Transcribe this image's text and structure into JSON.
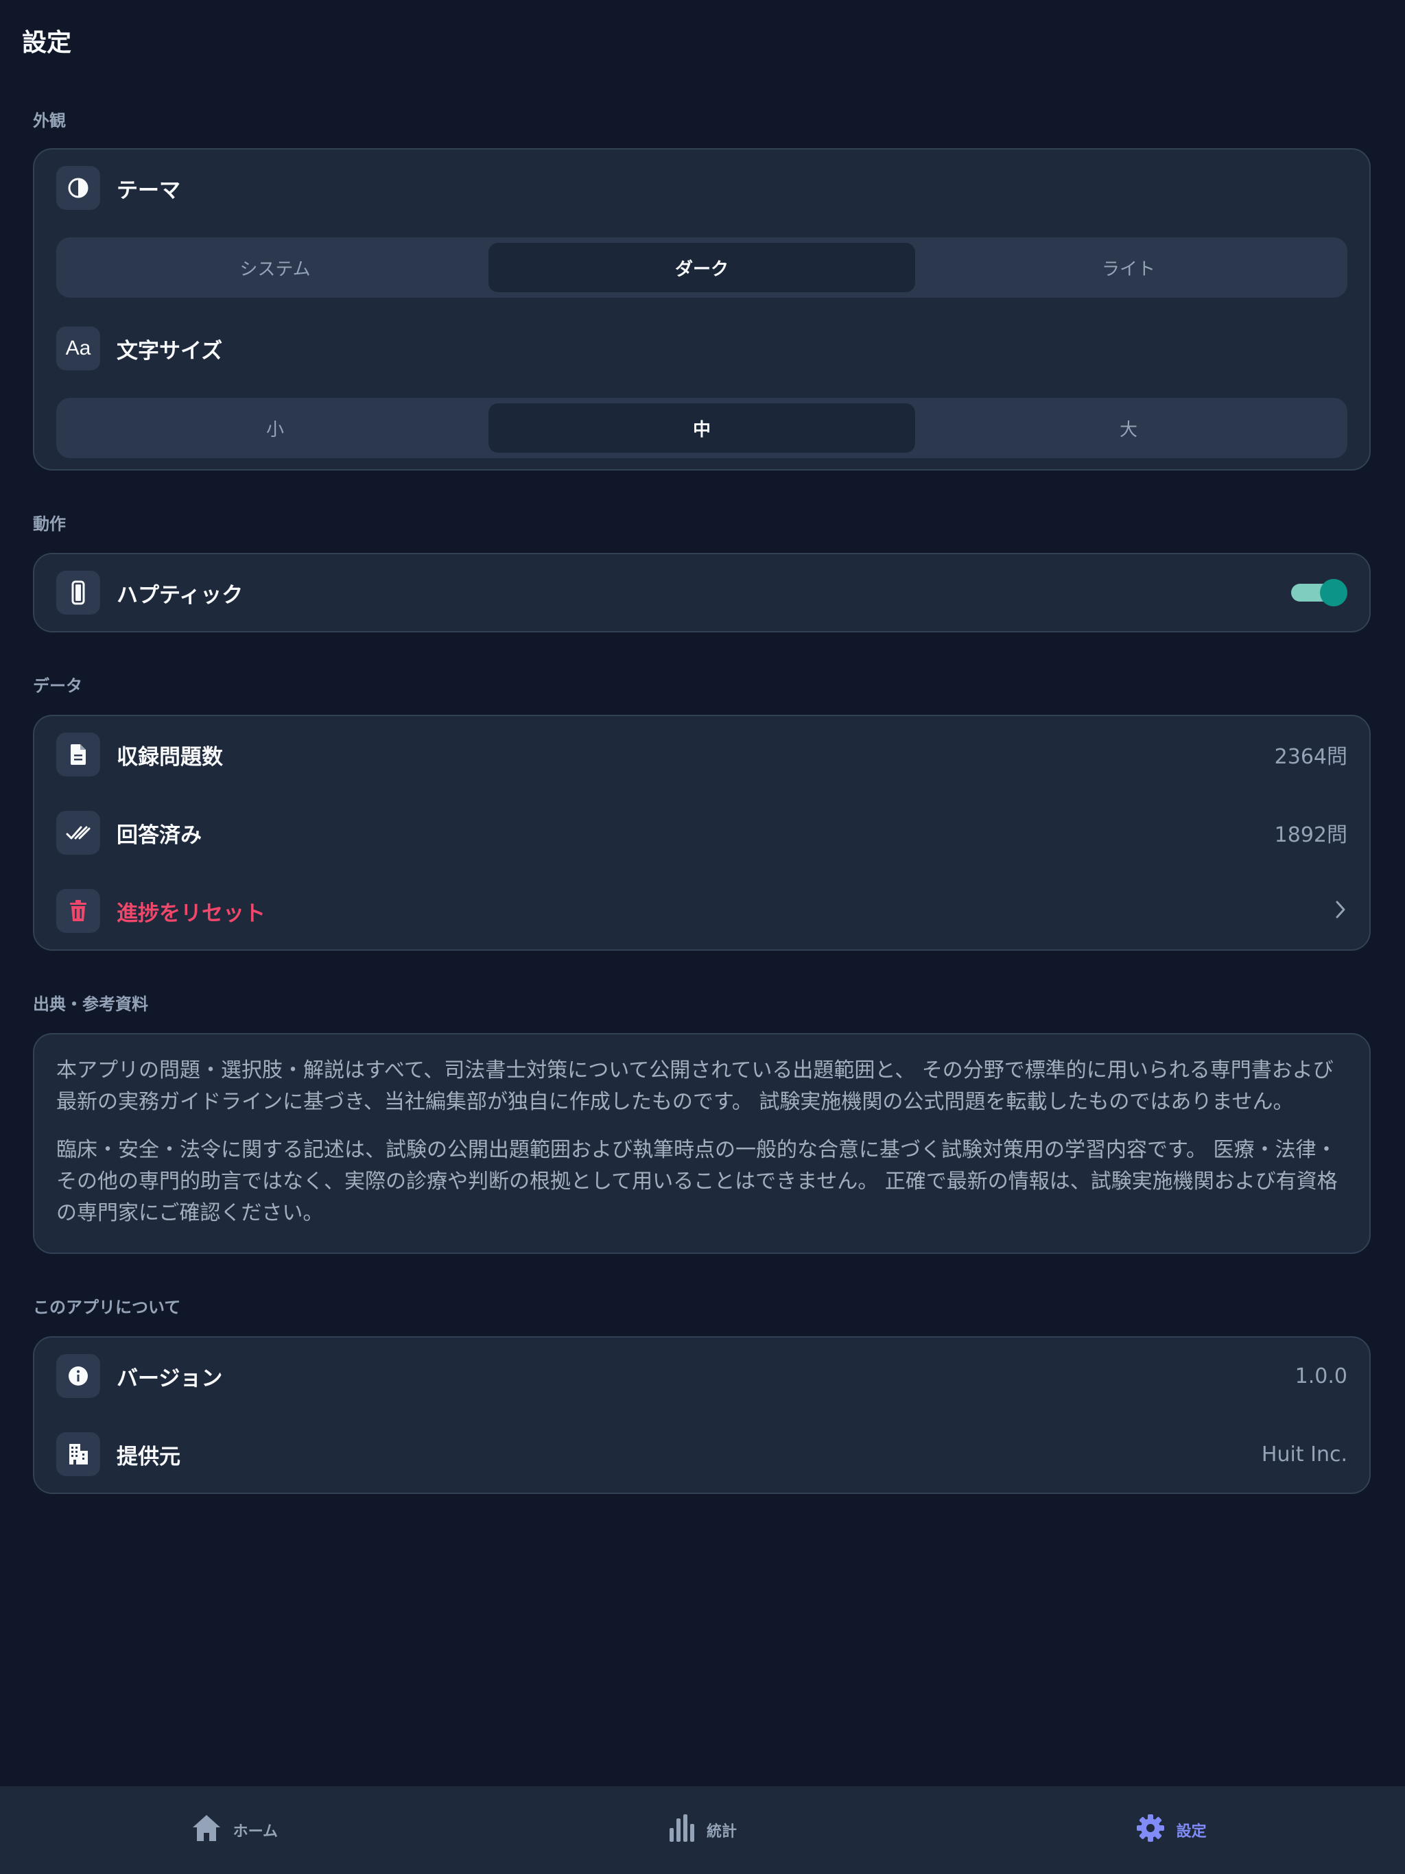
{
  "header": {
    "title": "設定"
  },
  "appearance": {
    "section_label": "外観",
    "theme": {
      "label": "テーマ",
      "icon": "contrast-icon",
      "options": [
        "システム",
        "ダーク",
        "ライト"
      ],
      "selected": "ダーク"
    },
    "font_size": {
      "label": "文字サイズ",
      "icon": "text-size-icon",
      "options": [
        "小",
        "中",
        "大"
      ],
      "selected": "中"
    }
  },
  "behavior": {
    "section_label": "動作",
    "haptic": {
      "label": "ハプティック",
      "icon": "phone-icon",
      "enabled": true
    }
  },
  "data_section": {
    "section_label": "データ",
    "total_questions": {
      "label": "収録問題数",
      "value": "2364問",
      "icon": "document-icon"
    },
    "answered": {
      "label": "回答済み",
      "value": "1892問",
      "icon": "double-check-icon"
    },
    "reset": {
      "label": "進捗をリセット",
      "icon": "trash-icon",
      "chevron": "chevron-right-icon"
    }
  },
  "sources": {
    "section_label": "出典・参考資料",
    "paragraphs": [
      "本アプリの問題・選択肢・解説はすべて、司法書士対策について公開されている出題範囲と、 その分野で標準的に用いられる専門書および最新の実務ガイドラインに基づき、当社編集部が独自に作成したものです。 試験実施機関の公式問題を転載したものではありません。",
      "臨床・安全・法令に関する記述は、試験の公開出題範囲および執筆時点の一般的な合意に基づく試験対策用の学習内容です。 医療・法律・その他の専門的助言ではなく、実際の診療や判断の根拠として用いることはできません。 正確で最新の情報は、試験実施機関および有資格の専門家にご確認ください。"
    ]
  },
  "about": {
    "section_label": "このアプリについて",
    "version": {
      "label": "バージョン",
      "value": "1.0.0",
      "icon": "info-icon"
    },
    "provider": {
      "label": "提供元",
      "value": "Huit Inc.",
      "icon": "building-icon"
    }
  },
  "nav": {
    "items": [
      {
        "label": "ホーム",
        "icon": "home-icon"
      },
      {
        "label": "統計",
        "icon": "bar-chart-icon"
      },
      {
        "label": "設定",
        "icon": "gear-icon"
      }
    ],
    "active": "設定"
  },
  "colors": {
    "background": "#0f1729",
    "card": "#1e293b",
    "accent": "#818cf8",
    "toggle_on": "#0d9488",
    "danger": "#f0476a"
  }
}
